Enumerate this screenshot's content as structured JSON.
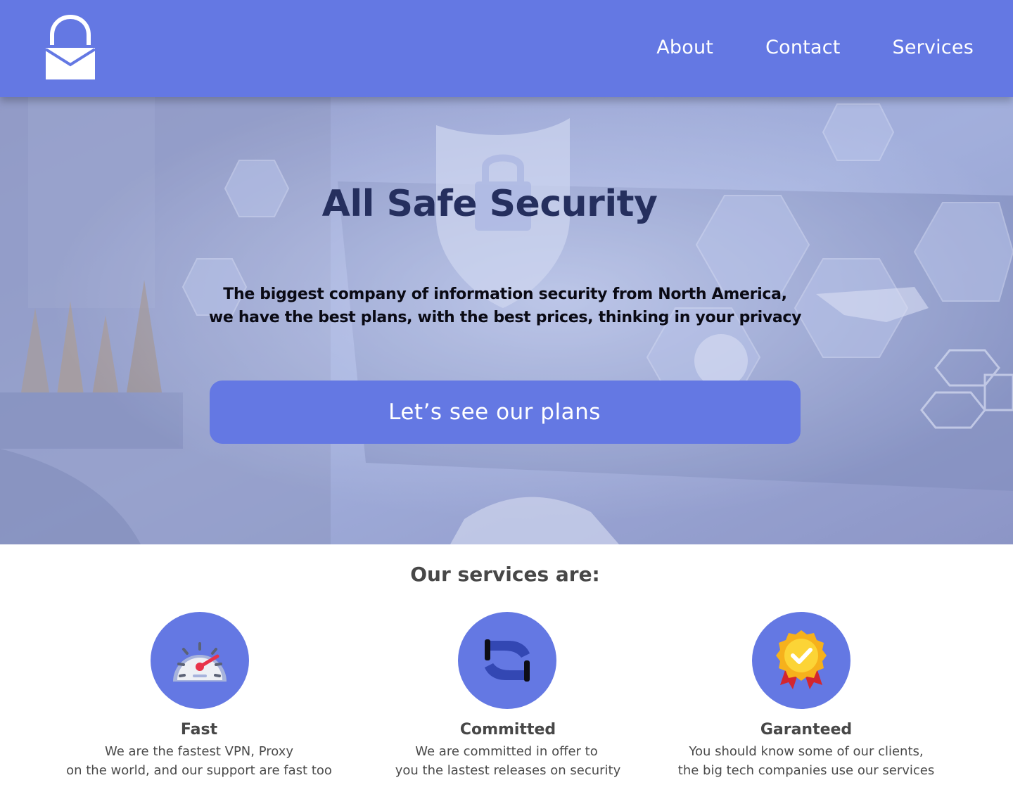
{
  "header": {
    "logo_icon": "lock-envelope-icon",
    "nav": [
      "About",
      "Contact",
      "Services"
    ],
    "background": "#6478e3"
  },
  "hero": {
    "title": "All Safe Security",
    "subtitle_line1": "The biggest company of information security from North America,",
    "subtitle_line2": "we have the best plans, with the best prices, thinking in your privacy",
    "cta_label": "Let’s see our plans",
    "background_icon": "cyber-security-shield-icon"
  },
  "services": {
    "title": "Our services are:",
    "items": [
      {
        "name": "Fast",
        "icon": "speedometer-icon",
        "line1": "We are the fastest VPN, Proxy",
        "line2": "on the world, and our support are fast too"
      },
      {
        "name": "Committed",
        "icon": "handshake-icon",
        "line1": "We are committed in offer to",
        "line2": "you the lastest releases on security"
      },
      {
        "name": "Garanteed",
        "icon": "award-badge-icon",
        "line1": "You should know some of our clients,",
        "line2": "the big tech companies use our services"
      }
    ]
  },
  "colors": {
    "accent": "#6478e3",
    "title_dark": "#252f5e",
    "text_gray": "#474747"
  }
}
